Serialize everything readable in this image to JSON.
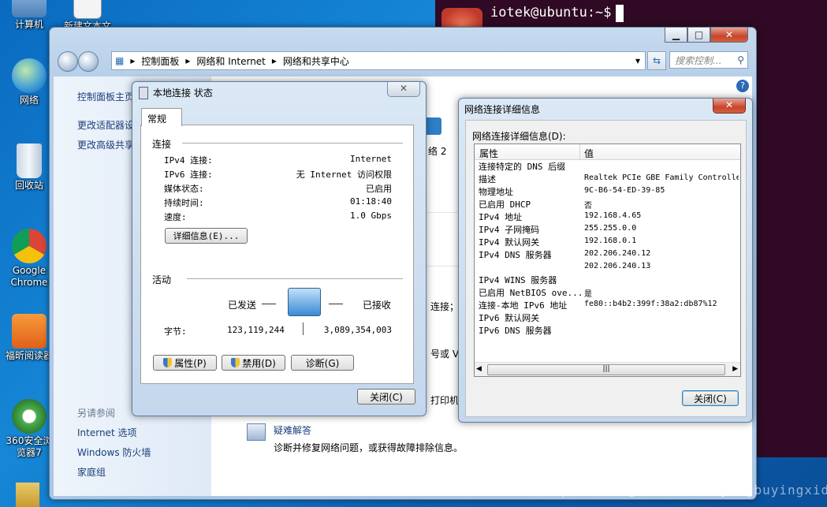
{
  "desktop": {
    "icons": [
      {
        "label": "计算机"
      },
      {
        "label": "新建文本文"
      },
      {
        "label": "网络"
      },
      {
        "label": "回收站"
      },
      {
        "label": "Google Chrome"
      },
      {
        "label": "福昕阅读器"
      },
      {
        "label": "360安全浏览器7"
      }
    ]
  },
  "terminal": {
    "prompt": "iotek@ubuntu:~$"
  },
  "explorer": {
    "breadcrumb": [
      "控制面板",
      "网络和 Internet",
      "网络和共享中心"
    ],
    "search_placeholder": "搜索控制...",
    "left_links": [
      "控制面板主页",
      "更改适配器设置",
      "更改高级共享设置"
    ],
    "see_also_title": "另请参阅",
    "see_also": [
      "Internet 选项",
      "Windows 防火墙",
      "家庭组"
    ],
    "right_fragments": [
      "络 2",
      "连接；",
      "号或 VP",
      "打印机，"
    ],
    "troubleshoot_link": "疑难解答",
    "troubleshoot_desc": "诊断并修复网络问题，或获得故障排除信息。"
  },
  "status_dialog": {
    "title": "本地连接 状态",
    "tab": "常规",
    "connection_header": "连接",
    "rows": [
      {
        "label": "IPv4 连接:",
        "value": "Internet"
      },
      {
        "label": "IPv6 连接:",
        "value": "无 Internet 访问权限"
      },
      {
        "label": "媒体状态:",
        "value": "已启用"
      },
      {
        "label": "持续时间:",
        "value": "01:18:40"
      },
      {
        "label": "速度:",
        "value": "1.0 Gbps"
      }
    ],
    "details_button": "详细信息(E)...",
    "activity_header": "活动",
    "sent_label": "已发送",
    "received_label": "已接收",
    "bytes_label": "字节:",
    "bytes_sent": "123,119,244",
    "bytes_received": "3,089,354,003",
    "properties_button": "属性(P)",
    "disable_button": "禁用(D)",
    "diagnose_button": "诊断(G)",
    "close_button": "关闭(C)"
  },
  "details_dialog": {
    "title": "网络连接详细信息",
    "list_label": "网络连接详细信息(D):",
    "col_property": "属性",
    "col_value": "值",
    "rows": [
      {
        "property": "连接特定的 DNS 后缀",
        "value": ""
      },
      {
        "property": "描述",
        "value": "Realtek PCIe GBE Family Controlle"
      },
      {
        "property": "物理地址",
        "value": "9C-B6-54-ED-39-85"
      },
      {
        "property": "已启用 DHCP",
        "value": "否"
      },
      {
        "property": "IPv4 地址",
        "value": "192.168.4.65"
      },
      {
        "property": "IPv4 子网掩码",
        "value": "255.255.0.0"
      },
      {
        "property": "IPv4 默认网关",
        "value": "192.168.0.1"
      },
      {
        "property": "IPv4 DNS 服务器",
        "value": "202.206.240.12"
      },
      {
        "property": "",
        "value": "202.206.240.13"
      },
      {
        "property": "IPv4 WINS 服务器",
        "value": ""
      },
      {
        "property": "已启用 NetBIOS ove...",
        "value": "是"
      },
      {
        "property": "连接-本地 IPv6 地址",
        "value": "fe80::b4b2:399f:38a2:db87%12"
      },
      {
        "property": "IPv6 默认网关",
        "value": ""
      },
      {
        "property": "IPv6 DNS 服务器",
        "value": ""
      }
    ],
    "close_button": "关闭(C)"
  },
  "watermark": "https://blog.csdn.net/yongbuyingxide"
}
